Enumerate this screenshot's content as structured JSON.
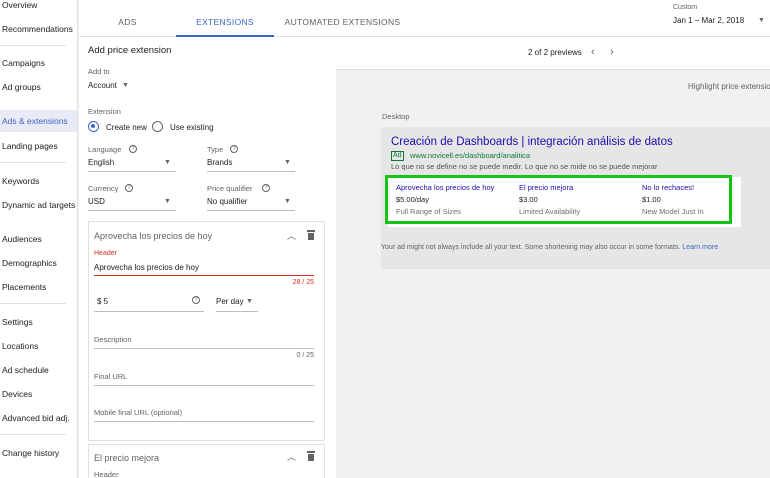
{
  "sidebar": {
    "items": [
      {
        "label": "Overview"
      },
      {
        "label": "Recommendations"
      },
      {
        "label": "Campaigns"
      },
      {
        "label": "Ad groups"
      },
      {
        "label": "Ads & extensions"
      },
      {
        "label": "Landing pages"
      },
      {
        "label": "Keywords"
      },
      {
        "label": "Dynamic ad targets"
      },
      {
        "label": "Audiences"
      },
      {
        "label": "Demographics"
      },
      {
        "label": "Placements"
      },
      {
        "label": "Settings"
      },
      {
        "label": "Locations"
      },
      {
        "label": "Ad schedule"
      },
      {
        "label": "Devices"
      },
      {
        "label": "Advanced bid adj."
      },
      {
        "label": "Change history"
      }
    ]
  },
  "tabs": [
    {
      "label": "ADS"
    },
    {
      "label": "EXTENSIONS"
    },
    {
      "label": "AUTOMATED EXTENSIONS"
    }
  ],
  "date": {
    "label": "Custom",
    "range": "Jan 1 – Mar 2, 2018"
  },
  "form": {
    "title": "Add price extension",
    "add_to_label": "Add to",
    "add_to_value": "Account",
    "extension_label": "Extension",
    "create_new": "Create new",
    "use_existing": "Use existing",
    "language_label": "Language",
    "language_value": "English",
    "type_label": "Type",
    "type_value": "Brands",
    "currency_label": "Currency",
    "currency_value": "USD",
    "qualifier_label": "Price qualifier",
    "qualifier_value": "No qualifier",
    "card1": {
      "title": "Aprovecha los precios de hoy",
      "header_label": "Header",
      "header_value": "Aprovecha los precios de hoy",
      "header_counter": "28 / 25",
      "price_value": "$ 5",
      "unit_value": "Per day",
      "description_label": "Description",
      "description_counter": "0 / 25",
      "final_url_label": "Final URL",
      "mobile_url_label": "Mobile final URL (optional)"
    },
    "card2": {
      "title": "El precio mejora",
      "header_label": "Header"
    }
  },
  "preview": {
    "count": "2 of 2 previews",
    "highlight": "Highlight price extension",
    "device": "Desktop",
    "ad_title": "Creación de Dashboards | integración análisis de datos",
    "ad_badge": "Ad",
    "ad_url": "www.novicell.es/dashboard/analitica",
    "ad_desc": "Lo que no se define no se puede medir. Lo que no se mide no se puede mejorar",
    "items": [
      {
        "header": "Aprovecha los precios de hoy",
        "price": "$5.00/day",
        "desc": "Full Range of Sizes"
      },
      {
        "header": "El precio mejora",
        "price": "$3.00",
        "desc": "Limited Availability"
      },
      {
        "header": "No lo rechaces!",
        "price": "$1.00",
        "desc": "New Model Just In"
      }
    ],
    "disclaimer": "Your ad might not always include all your text. Some shortening may also occur in some formats.",
    "learn_more": "Learn more"
  },
  "colors": {
    "accent": "#3c64c8",
    "highlight": "#13c213",
    "error": "#d93025",
    "link": "#1a0dab",
    "url": "#0b7a3b"
  },
  "icons": [
    "caret-down-icon",
    "help-icon",
    "chevron-up-icon",
    "trash-icon",
    "chevron-left-icon",
    "chevron-right-icon"
  ]
}
